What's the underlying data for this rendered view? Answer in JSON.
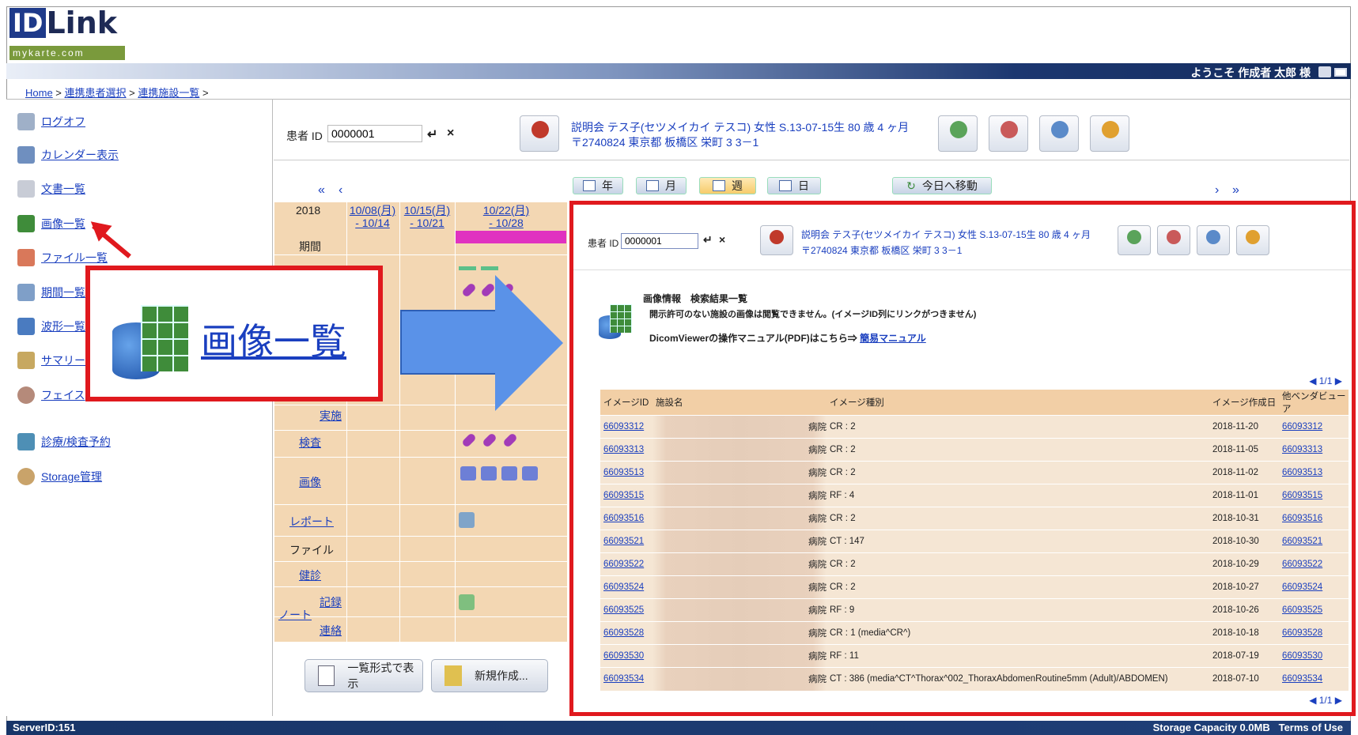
{
  "logo": {
    "id": "ID",
    "word": "Link",
    "sub": "mykarte.com"
  },
  "header": {
    "welcome": "ようこそ 作成者 太郎 様"
  },
  "breadcrumb": {
    "home": "Home",
    "sep": " > ",
    "patient_select": "連携患者選択",
    "facility_list": "連携施設一覧"
  },
  "sidebar": {
    "items": [
      {
        "label": "ログオフ",
        "icon": "lock-icon"
      },
      {
        "label": "カレンダー表示",
        "icon": "calendar-icon"
      },
      {
        "label": "文書一覧",
        "icon": "document-icon"
      },
      {
        "label": "画像一覧",
        "icon": "image-grid-icon"
      },
      {
        "label": "ファイル一覧",
        "icon": "file-icon"
      },
      {
        "label": "期間一覧",
        "icon": "period-icon"
      },
      {
        "label": "波形一覧",
        "icon": "waveform-icon"
      },
      {
        "label": "サマリー",
        "icon": "summary-icon"
      },
      {
        "label": "フェイス",
        "icon": "face-icon"
      },
      {
        "label": "診療/検査予約",
        "icon": "reservation-icon"
      },
      {
        "label": "Storage管理",
        "icon": "storage-icon"
      }
    ]
  },
  "patient": {
    "id_label": "患者 ID",
    "id_value": "0000001",
    "info_line1": "説明会 テス子(セツメイカイ テスコ)  女性   S.13-07-15生  80 歳 4 ヶ月",
    "info_line2": "〒2740824 東京都 板橋区 栄町 3 3－1"
  },
  "calendar": {
    "year": "2018",
    "views": [
      "年",
      "月",
      "週",
      "日"
    ],
    "today": "今日へ移動",
    "weeks": [
      {
        "start": "10/08(月)",
        "end": "- 10/14"
      },
      {
        "start": "10/15(月)",
        "end": "- 10/21"
      },
      {
        "start": "10/22(月)",
        "end": "- 10/28"
      }
    ],
    "rows": {
      "period": "期間",
      "impl": "実施",
      "exam": "検査",
      "image": "画像",
      "report": "レポート",
      "file": "ファイル",
      "checkup": "健診",
      "note": "ノート",
      "record": "記録",
      "contact": "連絡"
    },
    "list_button": "一覧形式で表示",
    "new_button": "新規作成..."
  },
  "zoom_label": "画像一覧",
  "results": {
    "title": "画像情報　検索結果一覧",
    "note": "開示許可のない施設の画像は閲覧できません。(イメージID列にリンクがつきません)",
    "manual_text": "DicomViewerの操作マニュアル(PDF)はこちら⇒ ",
    "manual_link": "簡易マニュアル",
    "pager": "1/1",
    "columns": [
      "イメージID",
      "施設名",
      "イメージ種別",
      "イメージ作成日",
      "他ベンダビューア"
    ],
    "rows": [
      {
        "id": "66093312",
        "facility_suffix": "病院",
        "type": "CR : 2",
        "date": "2018-11-20",
        "viewer": "66093312"
      },
      {
        "id": "66093313",
        "facility_suffix": "病院",
        "type": "CR : 2",
        "date": "2018-11-05",
        "viewer": "66093313"
      },
      {
        "id": "66093513",
        "facility_suffix": "病院",
        "type": "CR : 2",
        "date": "2018-11-02",
        "viewer": "66093513"
      },
      {
        "id": "66093515",
        "facility_suffix": "病院",
        "type": "RF : 4",
        "date": "2018-11-01",
        "viewer": "66093515"
      },
      {
        "id": "66093516",
        "facility_suffix": "病院",
        "type": "CR : 2",
        "date": "2018-10-31",
        "viewer": "66093516"
      },
      {
        "id": "66093521",
        "facility_suffix": "病院",
        "type": "CT : 147",
        "date": "2018-10-30",
        "viewer": "66093521"
      },
      {
        "id": "66093522",
        "facility_suffix": "病院",
        "type": "CR : 2",
        "date": "2018-10-29",
        "viewer": "66093522"
      },
      {
        "id": "66093524",
        "facility_suffix": "病院",
        "type": "CR : 2",
        "date": "2018-10-27",
        "viewer": "66093524"
      },
      {
        "id": "66093525",
        "facility_suffix": "病院",
        "type": "RF : 9",
        "date": "2018-10-26",
        "viewer": "66093525"
      },
      {
        "id": "66093528",
        "facility_suffix": "病院",
        "type": "CR : 1 (media^CR^)",
        "date": "2018-10-18",
        "viewer": "66093528"
      },
      {
        "id": "66093530",
        "facility_suffix": "病院",
        "type": "RF : 11",
        "date": "2018-07-19",
        "viewer": "66093530"
      },
      {
        "id": "66093534",
        "facility_suffix": "病院",
        "type": "CT : 386 (media^CT^Thorax^002_ThoraxAbdomenRoutine5mm (Adult)/ABDOMEN)",
        "date": "2018-07-10",
        "viewer": "66093534"
      }
    ]
  },
  "footer": {
    "server": "ServerID:151",
    "capacity": "Storage Capacity 0.0MB",
    "terms": "Terms of Use"
  }
}
